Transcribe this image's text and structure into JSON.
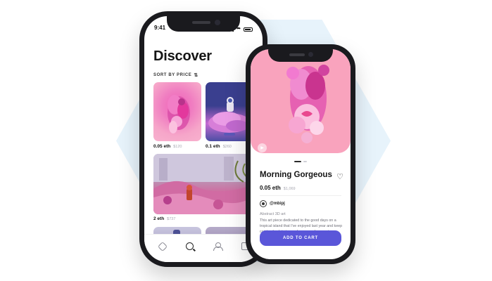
{
  "phone1": {
    "status_time": "9:41",
    "title": "Discover",
    "sort_label": "SORT BY PRICE",
    "sort_icon": "sort-icon",
    "cards": [
      {
        "eth": "0.05 eth",
        "usd": "$120"
      },
      {
        "eth": "0.1 eth",
        "usd": "$260"
      },
      {
        "eth": "2 eth",
        "usd": "$737"
      }
    ],
    "tabs": [
      "home-icon",
      "search-icon",
      "profile-icon",
      "bag-icon"
    ]
  },
  "phone2": {
    "title": "Morning Gorgeous",
    "price_eth": "0.05 eth",
    "price_usd": "$1,069",
    "author": "@mbipj",
    "art_type": "Abstract 3D art",
    "description": "This art piece dedicated to the good days on a tropical island that I've enjoyed last year and keep coming back to in my dreams and memories.",
    "cta_label": "ADD TO CART",
    "icons": [
      "play-icon",
      "heart-icon"
    ]
  },
  "colors": {
    "accent": "#5a56d9",
    "hero_pink": "#f9a3bd",
    "background_hex": "#e7f3fb"
  }
}
